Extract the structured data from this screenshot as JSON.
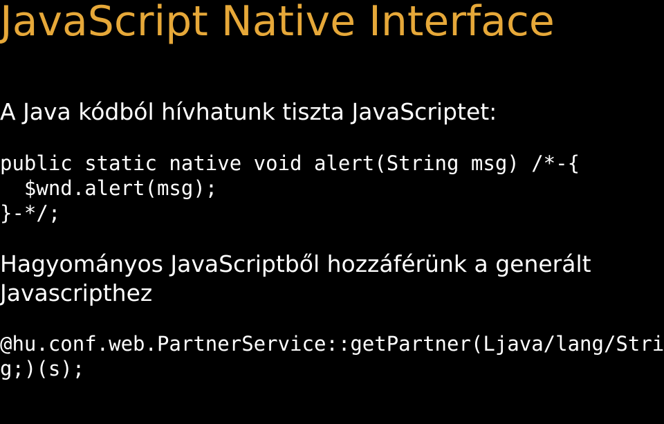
{
  "title": "JavaScript Native Interface",
  "paragraph1": "A Java kódból hívhatunk tiszta JavaScriptet:",
  "code1": "public static native void alert(String msg) /*-{\n  $wnd.alert(msg);\n}-*/;",
  "paragraph2": "Hagyományos JavaScriptből hozzáférünk a generált Javascripthez",
  "code2": "@hu.conf.web.PartnerService::getPartner(Ljava/lang/Strin\ng;)(s);"
}
